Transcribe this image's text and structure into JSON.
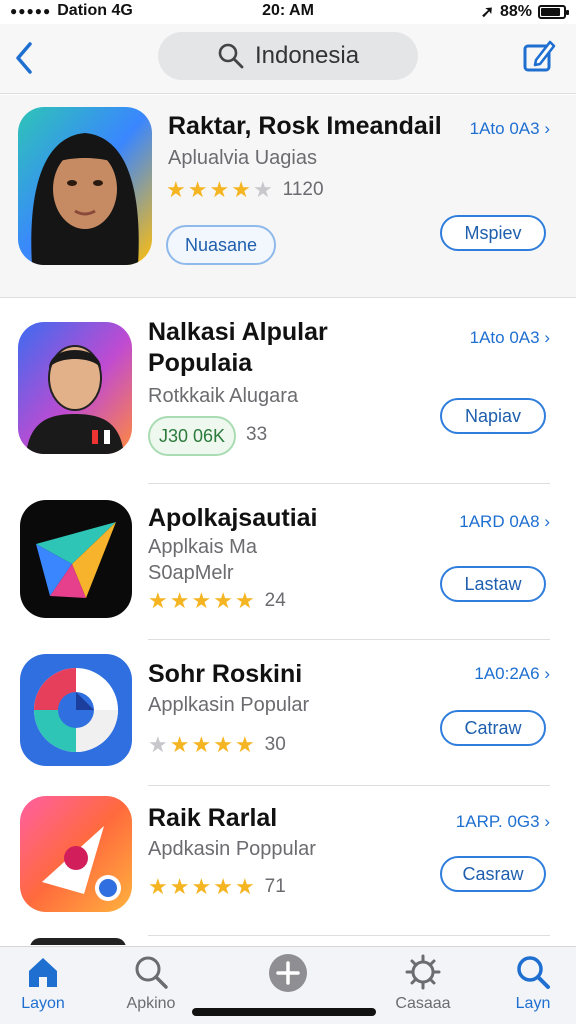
{
  "status_bar": {
    "carrier": "Dation 4G",
    "time": "20: AM",
    "battery": "88%",
    "battery_level": 0.88
  },
  "nav": {
    "search_text": "Indonesia"
  },
  "apps": [
    {
      "name": "Raktar, Rosk Imeandail",
      "subtitle": "Aplualvia Uagias",
      "rating": 4,
      "rating_count": "1120",
      "meta": "1Ato 0A3",
      "tag": "Nuasane",
      "action": "Mspiev"
    },
    {
      "name_line1": "Nalkasi Alpular",
      "name_line2": "Populaia",
      "subtitle": "Rotkkaik Alugara",
      "tag": "J30 06K",
      "rating_count": "33",
      "meta": "1Ato 0A3",
      "action": "Napiav"
    },
    {
      "name": "Apolkajsautiai",
      "subtitle_line1": "Applkais Ma",
      "subtitle_line2": "S0apMelr",
      "rating": 5,
      "rating_count": "24",
      "meta": "1ARD 0A8",
      "action": "Lastaw"
    },
    {
      "name": "Sohr Roskini",
      "subtitle": "Applkasin Popular",
      "rating": 4,
      "rating_count": "30",
      "meta": "1A0:2A6",
      "action": "Catraw"
    },
    {
      "name": "Raik Rarlal",
      "subtitle": "Apdkasin Poppular",
      "rating": 5,
      "rating_count": "71",
      "meta": "1ARP. 0G3",
      "action": "Casraw"
    }
  ],
  "tabs": [
    {
      "label": "Layon",
      "icon": "home-icon",
      "active": true
    },
    {
      "label": "Apkino",
      "icon": "search-icon",
      "active": false
    },
    {
      "label": "",
      "icon": "add-icon",
      "active": false
    },
    {
      "label": "Casaaa",
      "icon": "gear-icon",
      "active": false
    },
    {
      "label": "Layn",
      "icon": "search-icon",
      "active": true
    }
  ],
  "colors": {
    "accent": "#1f6fd1",
    "star": "#f5b523",
    "tag_green": "#2c7a3c"
  }
}
